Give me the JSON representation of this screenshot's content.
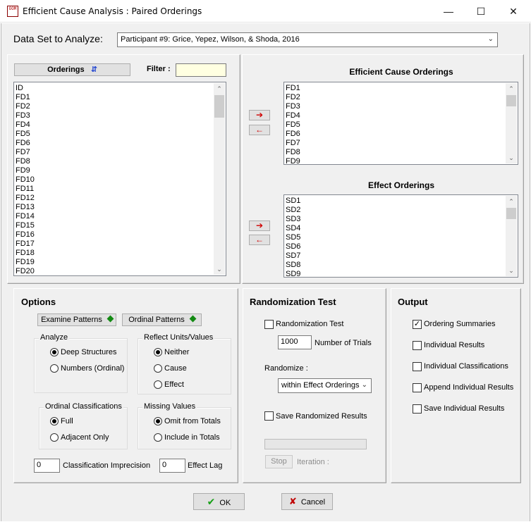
{
  "window": {
    "title": "Efficient Cause Analysis : Paired Orderings",
    "icon": "app-icon",
    "icon_text": "OOM",
    "controls": [
      "—",
      "☐",
      "✕"
    ]
  },
  "dataset": {
    "label": "Data Set to Analyze:",
    "selected": "Participant #9: Grice, Yepez, Wilson, & Shoda, 2016"
  },
  "orderings": {
    "button_label": "Orderings",
    "sort_icon": "⇵",
    "filter_label": "Filter :",
    "filter_value": "",
    "items": [
      "ID",
      "FD1",
      "FD2",
      "FD3",
      "FD4",
      "FD5",
      "FD6",
      "FD7",
      "FD8",
      "FD9",
      "FD10",
      "FD11",
      "FD12",
      "FD13",
      "FD14",
      "FD15",
      "FD16",
      "FD17",
      "FD18",
      "FD19",
      "FD20"
    ]
  },
  "efficient_cause": {
    "title": "Efficient Cause Orderings",
    "items": [
      "FD1",
      "FD2",
      "FD3",
      "FD4",
      "FD5",
      "FD6",
      "FD7",
      "FD8",
      "FD9"
    ]
  },
  "effect": {
    "title": "Effect Orderings",
    "items": [
      "SD1",
      "SD2",
      "SD3",
      "SD4",
      "SD5",
      "SD6",
      "SD7",
      "SD8",
      "SD9"
    ]
  },
  "move_buttons": {
    "add": "➔",
    "remove": "←"
  },
  "options": {
    "title": "Options",
    "examine_patterns": "Examine Patterns",
    "ordinal_patterns": "Ordinal Patterns",
    "analyze": {
      "title": "Analyze",
      "opt1": "Deep Structures",
      "opt2": "Numbers (Ordinal)"
    },
    "reflect": {
      "title": "Reflect Units/Values",
      "opt1": "Neither",
      "opt2": "Cause",
      "opt3": "Effect"
    },
    "ordinal_class": {
      "title": "Ordinal Classifications",
      "opt1": "Full",
      "opt2": "Adjacent Only"
    },
    "missing": {
      "title": "Missing Values",
      "opt1": "Omit from Totals",
      "opt2": "Include in Totals"
    },
    "imprecision_value": "0",
    "imprecision_label": "Classification Imprecision",
    "lag_value": "0",
    "lag_label": "Effect Lag"
  },
  "randomization": {
    "title": "Randomization Test",
    "test_label": "Randomization Test",
    "trials_value": "1000",
    "trials_label": "Number of Trials",
    "randomize_label": "Randomize :",
    "randomize_selected": "within Effect Orderings",
    "save_label": "Save Randomized Results",
    "stop_label": "Stop",
    "iteration_label": "Iteration :"
  },
  "output": {
    "title": "Output",
    "items": [
      "Ordering Summaries",
      "Individual Results",
      "Individual Classifications",
      "Append Individual Results",
      "Save Individual Results"
    ]
  },
  "footer": {
    "ok": "OK",
    "cancel": "Cancel"
  },
  "colors": {
    "accent_red": "#d00000",
    "accent_green": "#138a13",
    "filter_bg": "#ffffe1"
  }
}
